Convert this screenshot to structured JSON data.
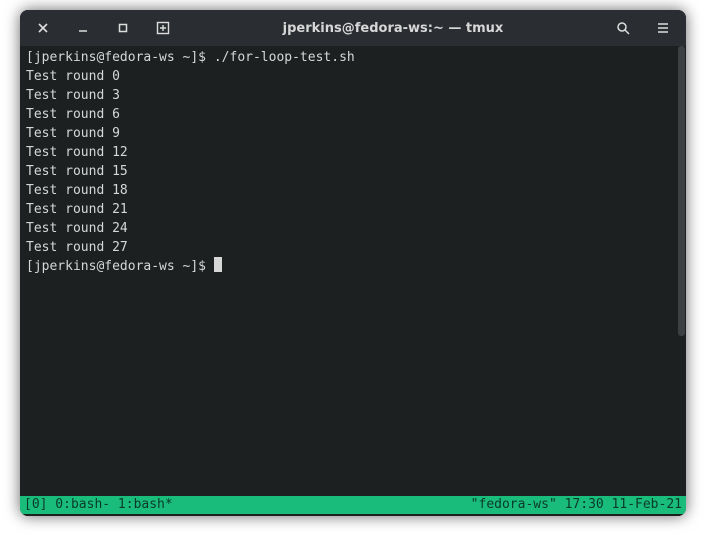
{
  "window": {
    "title": "jperkins@fedora-ws:~ — tmux"
  },
  "prompt1": "[jperkins@fedora-ws ~]$ ",
  "command": "./for-loop-test.sh",
  "output": [
    "Test round 0",
    "Test round 3",
    "Test round 6",
    "Test round 9",
    "Test round 12",
    "Test round 15",
    "Test round 18",
    "Test round 21",
    "Test round 24",
    "Test round 27"
  ],
  "prompt2": "[jperkins@fedora-ws ~]$ ",
  "tmux": {
    "left": "[0] 0:bash- 1:bash*",
    "right": "\"fedora-ws\" 17:30 11-Feb-21"
  }
}
